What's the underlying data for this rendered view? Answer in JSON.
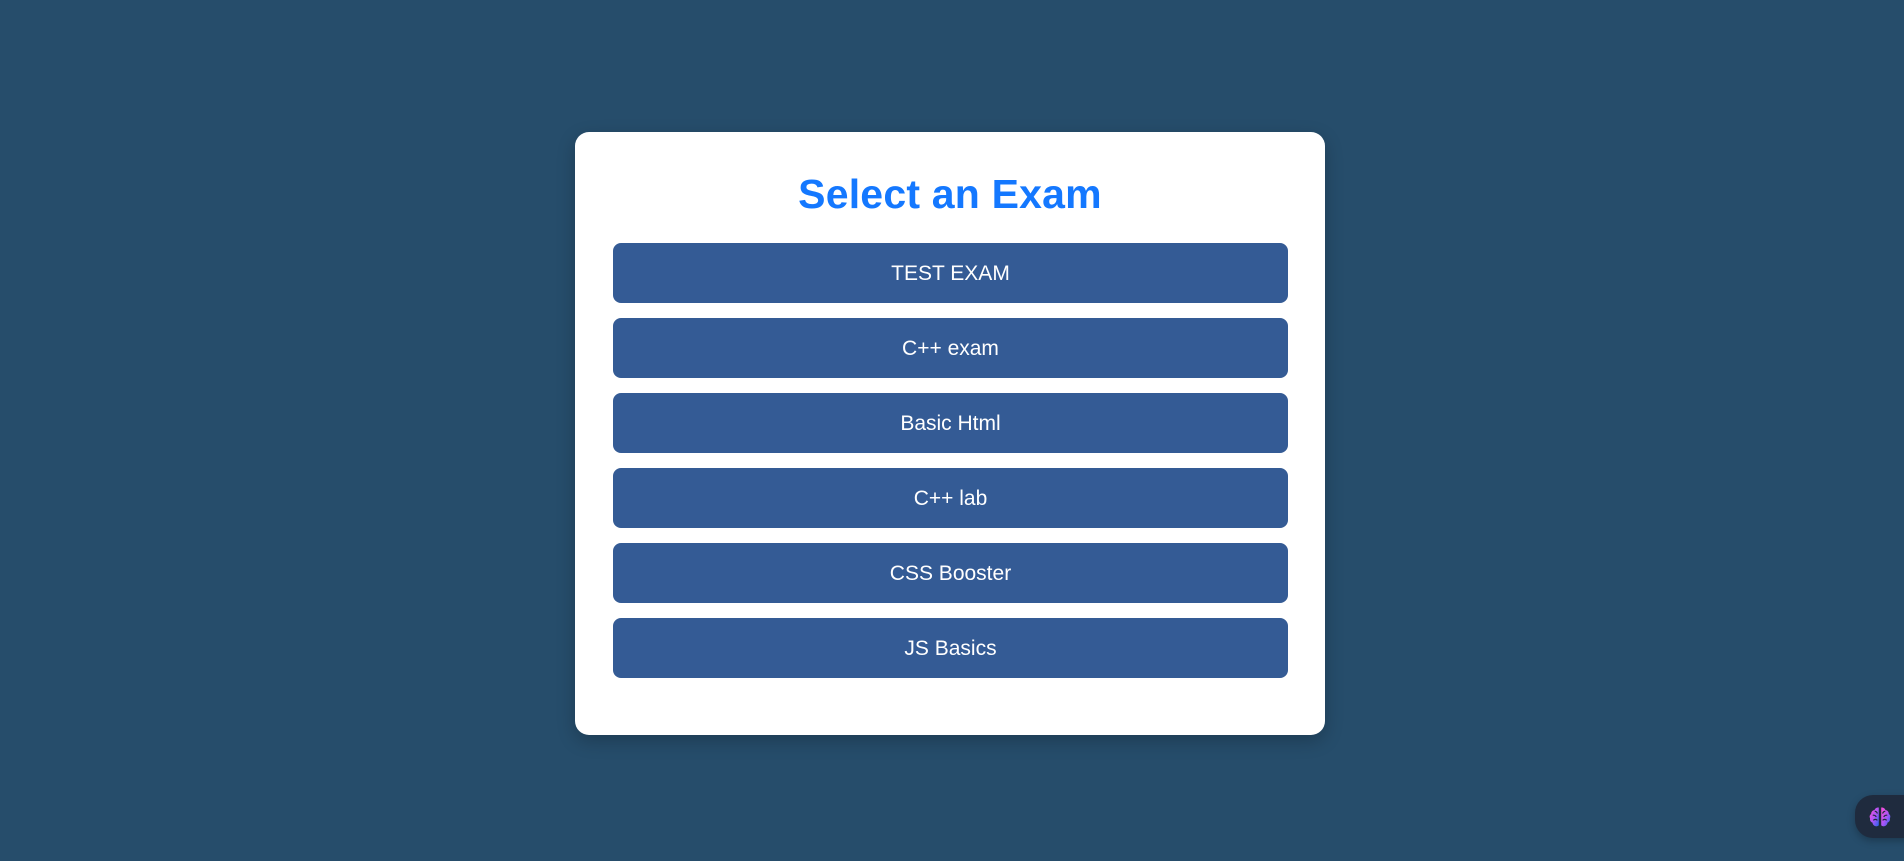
{
  "page": {
    "title": "Select an Exam"
  },
  "exams": [
    {
      "label": "TEST EXAM"
    },
    {
      "label": "C++ exam"
    },
    {
      "label": "Basic Html"
    },
    {
      "label": "C++ lab"
    },
    {
      "label": "CSS Booster"
    },
    {
      "label": "JS Basics"
    }
  ],
  "widget": {
    "icon": "brain-icon"
  },
  "colors": {
    "background": "#264d6b",
    "card": "#ffffff",
    "title": "#1478ff",
    "button": "#345b95",
    "button_text": "#ffffff",
    "widget": "#1f2b3e"
  }
}
